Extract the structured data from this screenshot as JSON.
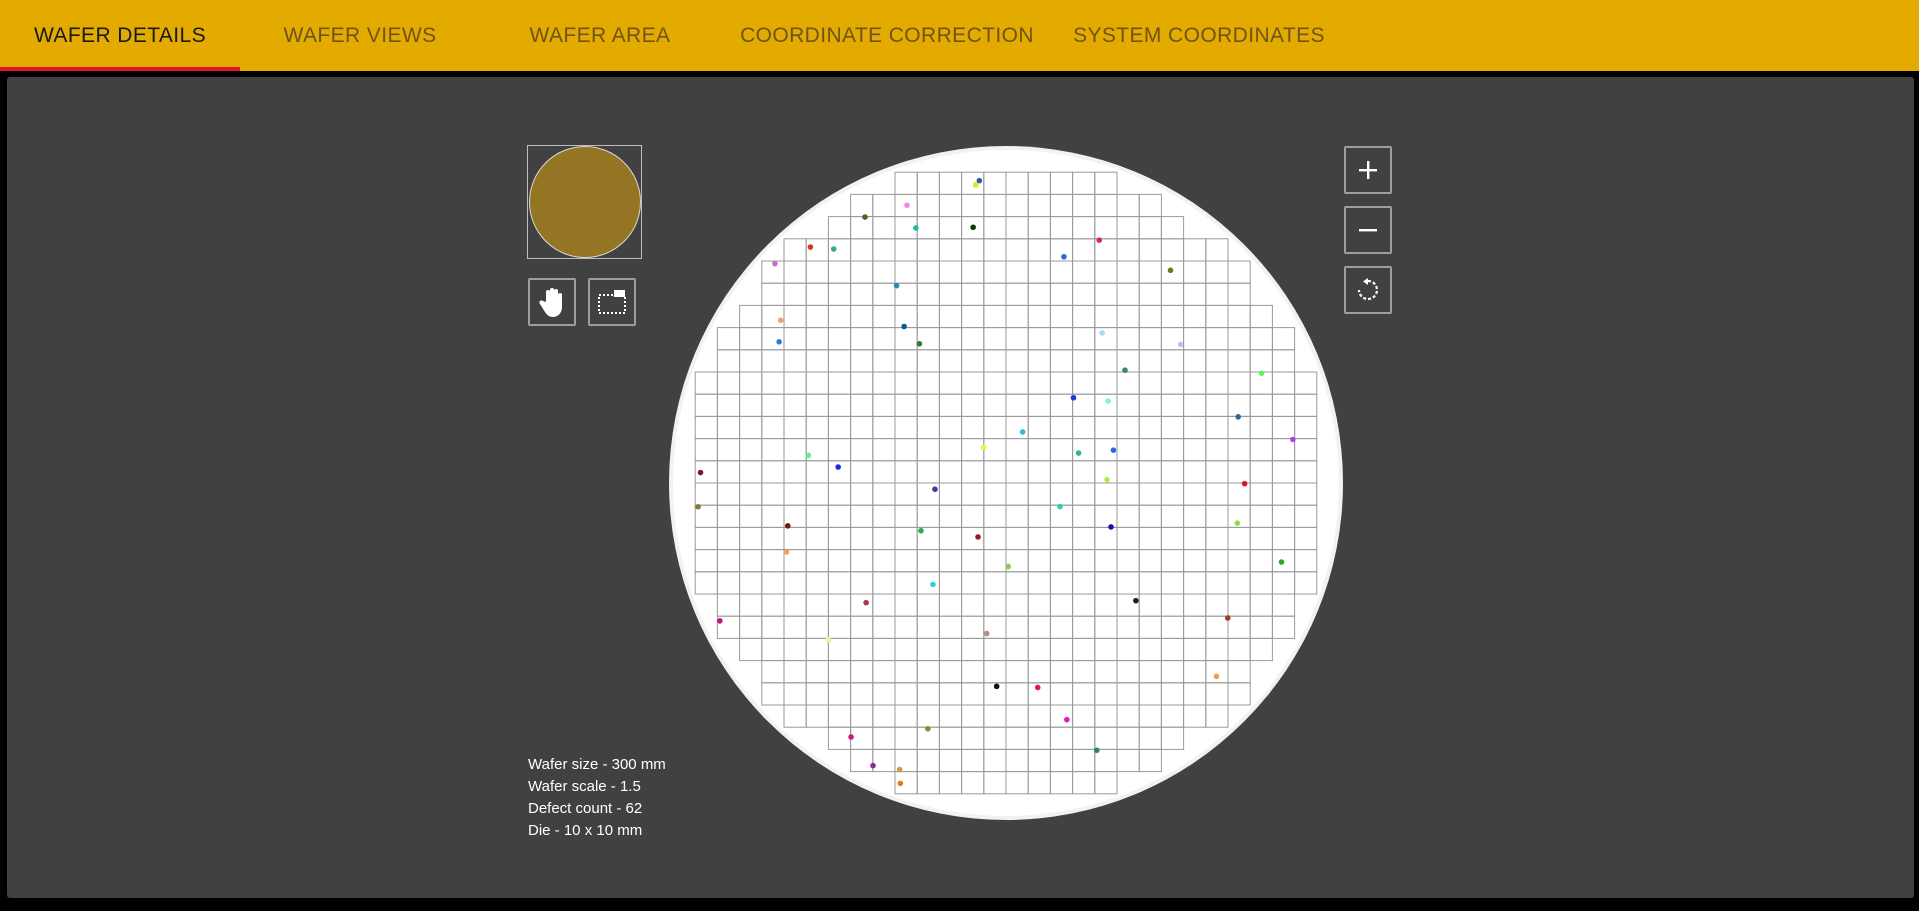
{
  "tabs": [
    {
      "label": "WAFER DETAILS",
      "active": true
    },
    {
      "label": "WAFER VIEWS",
      "active": false
    },
    {
      "label": "WAFER AREA",
      "active": false
    },
    {
      "label": "COORDINATE CORRECTION",
      "active": false
    },
    {
      "label": "SYSTEM COORDINATES",
      "active": false
    }
  ],
  "toolbar": {
    "pan_icon": "hand-icon",
    "select_icon": "rect-select-icon"
  },
  "zoom_controls": {
    "zoom_in_icon": "plus-icon",
    "zoom_out_icon": "minus-icon",
    "reset_icon": "rotate-reset-icon"
  },
  "info": {
    "wafer_size": "Wafer size - 300 mm",
    "wafer_scale": "Wafer scale - 1.5",
    "defect_count": "Defect count - 62",
    "die": "Die - 10 x 10 mm"
  },
  "colors": {
    "tab_bar": "#e3aa00",
    "tab_indicator": "#e0122c",
    "panel": "#414141",
    "minimap_wafer": "#947523",
    "wafer": "#ffffff",
    "die_grid": "#9a9a9a"
  },
  "wafer_map": {
    "diameter_mm": 300,
    "die_size_mm": [
      10,
      10
    ],
    "defects": [
      {
        "x": -13.6,
        "y": 134.3,
        "color": "#e2e21a"
      },
      {
        "x": -12.0,
        "y": 136.2,
        "color": "#2a5e9a"
      },
      {
        "x": -63.5,
        "y": 119.8,
        "color": "#5a5a2a"
      },
      {
        "x": -44.6,
        "y": 125.1,
        "color": "#ee88ee"
      },
      {
        "x": -14.8,
        "y": 115.2,
        "color": "#0a3a0a"
      },
      {
        "x": -40.6,
        "y": 114.9,
        "color": "#1abfa0"
      },
      {
        "x": -88.1,
        "y": 106.3,
        "color": "#cc3a1a"
      },
      {
        "x": -77.6,
        "y": 105.4,
        "color": "#3aaa8a"
      },
      {
        "x": -104.1,
        "y": 98.8,
        "color": "#cc6ad0"
      },
      {
        "x": 26.1,
        "y": 101.9,
        "color": "#2a6adf"
      },
      {
        "x": 42.0,
        "y": 109.4,
        "color": "#dd2a4a"
      },
      {
        "x": -49.3,
        "y": 88.9,
        "color": "#2a8aaa"
      },
      {
        "x": 74.1,
        "y": 95.8,
        "color": "#6a7a1a"
      },
      {
        "x": -101.5,
        "y": 73.3,
        "color": "#f0a080"
      },
      {
        "x": -45.9,
        "y": 70.5,
        "color": "#0a5a8a"
      },
      {
        "x": -39.0,
        "y": 62.7,
        "color": "#2a7a3a"
      },
      {
        "x": 43.3,
        "y": 67.6,
        "color": "#aaddee"
      },
      {
        "x": -102.2,
        "y": 63.6,
        "color": "#2a7adf"
      },
      {
        "x": 78.7,
        "y": 62.4,
        "color": "#ccbbdd"
      },
      {
        "x": 53.6,
        "y": 50.8,
        "color": "#3a8a5a"
      },
      {
        "x": 115.1,
        "y": 49.4,
        "color": "#66ee66"
      },
      {
        "x": 30.4,
        "y": 38.4,
        "color": "#1a3ad0"
      },
      {
        "x": 46.0,
        "y": 36.9,
        "color": "#88f0cc"
      },
      {
        "x": 104.6,
        "y": 29.8,
        "color": "#2a6a9a"
      },
      {
        "x": 7.5,
        "y": 23.0,
        "color": "#2ac0d0"
      },
      {
        "x": 129.2,
        "y": 19.6,
        "color": "#aa44ee"
      },
      {
        "x": -10.1,
        "y": 16.0,
        "color": "#eeee44"
      },
      {
        "x": 32.7,
        "y": 13.5,
        "color": "#2abf7a"
      },
      {
        "x": 48.4,
        "y": 14.8,
        "color": "#2a6adf"
      },
      {
        "x": -89.0,
        "y": 12.4,
        "color": "#66ee88"
      },
      {
        "x": -75.6,
        "y": 7.2,
        "color": "#1a2ae0"
      },
      {
        "x": -137.6,
        "y": 4.7,
        "color": "#7a1a3a"
      },
      {
        "x": 45.5,
        "y": 1.5,
        "color": "#aaf044"
      },
      {
        "x": 107.5,
        "y": -0.3,
        "color": "#dd1a1a"
      },
      {
        "x": -32.0,
        "y": -2.8,
        "color": "#4a3a9a"
      },
      {
        "x": 24.3,
        "y": -10.6,
        "color": "#2ad0b0"
      },
      {
        "x": -138.7,
        "y": -10.7,
        "color": "#8a7a3a"
      },
      {
        "x": 104.2,
        "y": -18.1,
        "color": "#88e044"
      },
      {
        "x": -98.3,
        "y": -19.3,
        "color": "#6a1a1a"
      },
      {
        "x": 47.3,
        "y": -19.8,
        "color": "#2a0aaa"
      },
      {
        "x": -38.3,
        "y": -21.5,
        "color": "#2aaf4a"
      },
      {
        "x": -12.6,
        "y": -24.3,
        "color": "#9a1a2a"
      },
      {
        "x": 124.1,
        "y": -35.6,
        "color": "#2aaa2a"
      },
      {
        "x": -98.9,
        "y": -31.1,
        "color": "#f0a060"
      },
      {
        "x": 1.0,
        "y": -37.6,
        "color": "#88d040"
      },
      {
        "x": -32.9,
        "y": -45.7,
        "color": "#2ad0e0"
      },
      {
        "x": -63.0,
        "y": -53.9,
        "color": "#aa3a4a"
      },
      {
        "x": 58.5,
        "y": -53.0,
        "color": "#1a1a3a"
      },
      {
        "x": 99.9,
        "y": -60.8,
        "color": "#aa3a2a"
      },
      {
        "x": -128.9,
        "y": -62.1,
        "color": "#bb1a7a"
      },
      {
        "x": -8.7,
        "y": -67.8,
        "color": "#bb8a7a"
      },
      {
        "x": -80.0,
        "y": -70.6,
        "color": "#f0f0a0"
      },
      {
        "x": 94.8,
        "y": -87.1,
        "color": "#f0a044"
      },
      {
        "x": -4.2,
        "y": -91.6,
        "color": "#111111"
      },
      {
        "x": 14.3,
        "y": -92.1,
        "color": "#dd1a5a"
      },
      {
        "x": 27.4,
        "y": -106.6,
        "color": "#dd1acc"
      },
      {
        "x": -35.2,
        "y": -110.7,
        "color": "#8a8a3a"
      },
      {
        "x": -69.8,
        "y": -114.4,
        "color": "#cc1a7a"
      },
      {
        "x": 40.9,
        "y": -120.4,
        "color": "#2a8a5a"
      },
      {
        "x": -59.9,
        "y": -127.3,
        "color": "#8a2a9a"
      },
      {
        "x": -47.9,
        "y": -129.1,
        "color": "#c8a040"
      },
      {
        "x": -47.6,
        "y": -135.3,
        "color": "#e0801a"
      }
    ]
  }
}
